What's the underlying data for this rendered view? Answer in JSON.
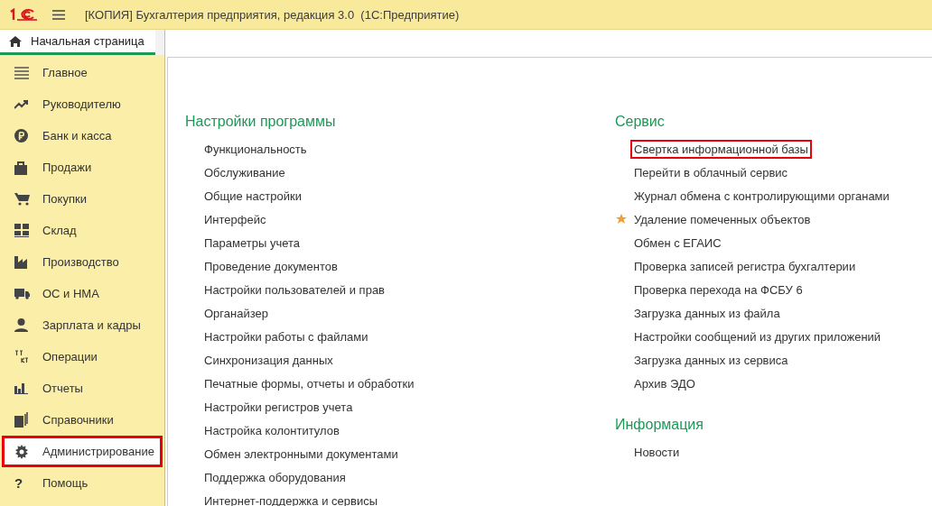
{
  "window": {
    "title": "[КОПИЯ] Бухгалтерия предприятия, редакция 3.0  (1С:Предприятие)"
  },
  "tabs": [
    {
      "label": "Начальная страница",
      "selected": true
    }
  ],
  "sidebar": {
    "items": [
      {
        "label": "Главное",
        "selected": false,
        "highlighted": false
      },
      {
        "label": "Руководителю",
        "selected": false,
        "highlighted": false
      },
      {
        "label": "Банк и касса",
        "selected": false,
        "highlighted": false
      },
      {
        "label": "Продажи",
        "selected": false,
        "highlighted": false
      },
      {
        "label": "Покупки",
        "selected": false,
        "highlighted": false
      },
      {
        "label": "Склад",
        "selected": false,
        "highlighted": false
      },
      {
        "label": "Производство",
        "selected": false,
        "highlighted": false
      },
      {
        "label": "ОС и НМА",
        "selected": false,
        "highlighted": false
      },
      {
        "label": "Зарплата и кадры",
        "selected": false,
        "highlighted": false
      },
      {
        "label": "Операции",
        "selected": false,
        "highlighted": false
      },
      {
        "label": "Отчеты",
        "selected": false,
        "highlighted": false
      },
      {
        "label": "Справочники",
        "selected": false,
        "highlighted": false
      },
      {
        "label": "Администрирование",
        "selected": true,
        "highlighted": true
      },
      {
        "label": "Помощь",
        "selected": false,
        "highlighted": false,
        "icon_text": "?"
      }
    ]
  },
  "sections": [
    {
      "title": "Настройки программы",
      "items": [
        {
          "label": "Функциональность",
          "favorite": false,
          "highlighted": false
        },
        {
          "label": "Обслуживание",
          "favorite": false,
          "highlighted": false
        },
        {
          "label": "Общие настройки",
          "favorite": false,
          "highlighted": false
        },
        {
          "label": "Интерфейс",
          "favorite": false,
          "highlighted": false
        },
        {
          "label": "Параметры учета",
          "favorite": false,
          "highlighted": false
        },
        {
          "label": "Проведение документов",
          "favorite": false,
          "highlighted": false
        },
        {
          "label": "Настройки пользователей и прав",
          "favorite": false,
          "highlighted": false
        },
        {
          "label": "Органайзер",
          "favorite": false,
          "highlighted": false
        },
        {
          "label": "Настройки работы с файлами",
          "favorite": false,
          "highlighted": false
        },
        {
          "label": "Синхронизация данных",
          "favorite": false,
          "highlighted": false
        },
        {
          "label": "Печатные формы, отчеты и обработки",
          "favorite": false,
          "highlighted": false
        },
        {
          "label": "Настройки регистров учета",
          "favorite": false,
          "highlighted": false
        },
        {
          "label": "Настройка колонтитулов",
          "favorite": false,
          "highlighted": false
        },
        {
          "label": "Обмен электронными документами",
          "favorite": false,
          "highlighted": false
        },
        {
          "label": "Поддержка оборудования",
          "favorite": false,
          "highlighted": false
        },
        {
          "label": "Интернет-поддержка и сервисы",
          "favorite": false,
          "highlighted": false
        }
      ]
    },
    {
      "title": "Сервис",
      "items": [
        {
          "label": "Свертка информационной базы",
          "favorite": false,
          "highlighted": true
        },
        {
          "label": "Перейти в облачный сервис",
          "favorite": false,
          "highlighted": false
        },
        {
          "label": "Журнал обмена с контролирующими органами",
          "favorite": false,
          "highlighted": false
        },
        {
          "label": "Удаление помеченных объектов",
          "favorite": true,
          "highlighted": false
        },
        {
          "label": "Обмен с ЕГАИС",
          "favorite": false,
          "highlighted": false
        },
        {
          "label": "Проверка записей регистра бухгалтерии",
          "favorite": false,
          "highlighted": false
        },
        {
          "label": "Проверка перехода на ФСБУ 6",
          "favorite": false,
          "highlighted": false
        },
        {
          "label": "Загрузка данных из файла",
          "favorite": false,
          "highlighted": false
        },
        {
          "label": "Настройки сообщений из других приложений",
          "favorite": false,
          "highlighted": false
        },
        {
          "label": "Загрузка данных из сервиса",
          "favorite": false,
          "highlighted": false
        },
        {
          "label": "Архив ЭДО",
          "favorite": false,
          "highlighted": false
        }
      ]
    },
    {
      "title": "Информация",
      "items": [
        {
          "label": "Новости",
          "favorite": false,
          "highlighted": false
        }
      ]
    }
  ]
}
